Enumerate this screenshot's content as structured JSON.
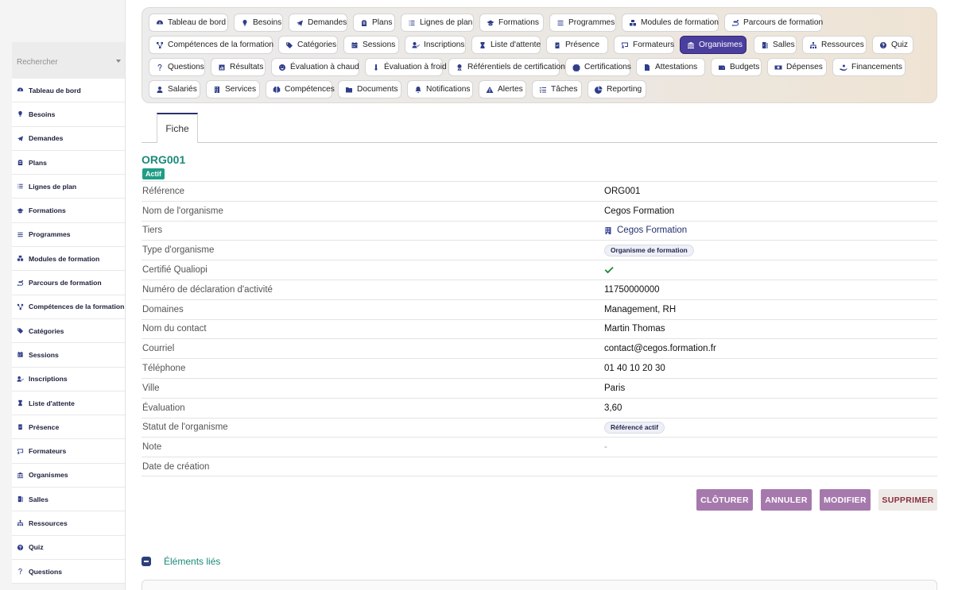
{
  "search": {
    "placeholder": "Rechercher"
  },
  "sidebar": {
    "items": [
      {
        "label": "Tableau de bord",
        "icon": "dashboard-icon"
      },
      {
        "label": "Besoins",
        "icon": "lightbulb-icon"
      },
      {
        "label": "Demandes",
        "icon": "paper-plane-icon"
      },
      {
        "label": "Plans",
        "icon": "clipboard-icon"
      },
      {
        "label": "Lignes de plan",
        "icon": "list-icon"
      },
      {
        "label": "Formations",
        "icon": "graduation-cap-icon"
      },
      {
        "label": "Programmes",
        "icon": "bars-icon"
      },
      {
        "label": "Modules de formation",
        "icon": "cubes-icon"
      },
      {
        "label": "Parcours de formation",
        "icon": "route-icon"
      },
      {
        "label": "Compétences de la formation",
        "icon": "project-diagram-icon"
      },
      {
        "label": "Catégories",
        "icon": "tags-icon"
      },
      {
        "label": "Sessions",
        "icon": "calendar-icon"
      },
      {
        "label": "Inscriptions",
        "icon": "user-check-icon"
      },
      {
        "label": "Liste d'attente",
        "icon": "hourglass-icon"
      },
      {
        "label": "Présence",
        "icon": "clipboard-check-icon"
      },
      {
        "label": "Formateurs",
        "icon": "chalkboard-teacher-icon"
      },
      {
        "label": "Organismes",
        "icon": "landmark-icon"
      },
      {
        "label": "Salles",
        "icon": "door-icon"
      },
      {
        "label": "Ressources",
        "icon": "sitemap-icon"
      },
      {
        "label": "Quiz",
        "icon": "question-circle-icon"
      },
      {
        "label": "Questions",
        "icon": "question-icon"
      }
    ]
  },
  "topnav": {
    "rows": [
      [
        {
          "label": "Tableau de bord",
          "icon": "dashboard-icon",
          "active": false
        },
        {
          "label": "Besoins",
          "icon": "lightbulb-icon",
          "active": false
        },
        {
          "label": "Demandes",
          "icon": "paper-plane-icon",
          "active": false
        },
        {
          "label": "Plans",
          "icon": "clipboard-icon",
          "active": false
        },
        {
          "label": "Lignes de plan",
          "icon": "list-icon",
          "active": false
        },
        {
          "label": "Formations",
          "icon": "graduation-cap-icon",
          "active": false
        },
        {
          "label": "Programmes",
          "icon": "bars-icon",
          "active": false
        },
        {
          "label": "Modules de formation",
          "icon": "cubes-icon",
          "active": false
        },
        {
          "label": "Parcours de formation",
          "icon": "route-icon",
          "active": false
        }
      ],
      [
        {
          "label": "Compétences de la formation",
          "icon": "project-diagram-icon",
          "active": false
        },
        {
          "label": "Catégories",
          "icon": "tags-icon",
          "active": false
        },
        {
          "label": "Sessions",
          "icon": "calendar-icon",
          "active": false
        },
        {
          "label": "Inscriptions",
          "icon": "user-check-icon",
          "active": false
        },
        {
          "label": "Liste d'attente",
          "icon": "hourglass-icon",
          "active": false
        },
        {
          "label": "Présence",
          "icon": "clipboard-check-icon",
          "active": false
        },
        {
          "label": "Formateurs",
          "icon": "chalkboard-teacher-icon",
          "active": false
        },
        {
          "label": "Organismes",
          "icon": "landmark-icon",
          "active": true
        },
        {
          "label": "Salles",
          "icon": "door-icon",
          "active": false
        },
        {
          "label": "Ressources",
          "icon": "sitemap-icon",
          "active": false
        },
        {
          "label": "Quiz",
          "icon": "question-circle-icon",
          "active": false
        }
      ],
      [
        {
          "label": "Questions",
          "icon": "question-icon",
          "active": false
        },
        {
          "label": "Résultats",
          "icon": "poll-icon",
          "active": false
        },
        {
          "label": "Évaluation à chaud",
          "icon": "smile-icon",
          "active": false
        },
        {
          "label": "Évaluation à froid",
          "icon": "thermometer-icon",
          "active": false
        },
        {
          "label": "Référentiels de certification",
          "icon": "award-icon",
          "active": false
        },
        {
          "label": "Certifications",
          "icon": "certificate-icon",
          "active": false
        },
        {
          "label": "Attestations",
          "icon": "file-signature-icon",
          "active": false
        },
        {
          "label": "Budgets",
          "icon": "wallet-icon",
          "active": false
        },
        {
          "label": "Dépenses",
          "icon": "money-bill-icon",
          "active": false
        },
        {
          "label": "Financements",
          "icon": "hand-holding-icon",
          "active": false
        }
      ],
      [
        {
          "label": "Salariés",
          "icon": "user-icon",
          "active": false
        },
        {
          "label": "Services",
          "icon": "building-icon",
          "active": false
        },
        {
          "label": "Compétences",
          "icon": "brain-icon",
          "active": false
        },
        {
          "label": "Documents",
          "icon": "folder-icon",
          "active": false
        },
        {
          "label": "Notifications",
          "icon": "bell-icon",
          "active": false
        },
        {
          "label": "Alertes",
          "icon": "warning-icon",
          "active": false
        },
        {
          "label": "Tâches",
          "icon": "tasks-icon",
          "active": false
        },
        {
          "label": "Reporting",
          "icon": "chart-pie-icon",
          "active": false
        }
      ]
    ]
  },
  "tabs": {
    "fiche": "Fiche"
  },
  "record": {
    "title": "ORG001",
    "status": "Actif",
    "fields": [
      {
        "label": "Référence",
        "value": "ORG001",
        "kind": "text"
      },
      {
        "label": "Nom de l'organisme",
        "value": "Cegos Formation",
        "kind": "text"
      },
      {
        "label": "Tiers",
        "value": "Cegos Formation",
        "kind": "link"
      },
      {
        "label": "Type d'organisme",
        "value": "Organisme de formation",
        "kind": "badge"
      },
      {
        "label": "Certifié Qualiopi",
        "value": "",
        "kind": "check"
      },
      {
        "label": "Numéro de déclaration d'activité",
        "value": "11750000000",
        "kind": "text"
      },
      {
        "label": "Domaines",
        "value": "Management, RH",
        "kind": "text"
      },
      {
        "label": "Nom du contact",
        "value": "Martin Thomas",
        "kind": "text"
      },
      {
        "label": "Courriel",
        "value": "contact@cegos.formation.fr",
        "kind": "text"
      },
      {
        "label": "Téléphone",
        "value": "01 40 10 20 30",
        "kind": "text"
      },
      {
        "label": "Ville",
        "value": "Paris",
        "kind": "text"
      },
      {
        "label": "Évaluation",
        "value": "3,60",
        "kind": "text"
      },
      {
        "label": "Statut de l'organisme",
        "value": "Référencé actif",
        "kind": "badge"
      },
      {
        "label": "Note",
        "value": "-",
        "kind": "muted"
      },
      {
        "label": "Date de création",
        "value": "",
        "kind": "text"
      }
    ]
  },
  "actions": {
    "cloturer": "CLÔTURER",
    "annuler": "ANNULER",
    "modifier": "MODIFIER",
    "supprimer": "SUPPRIMER"
  },
  "linked": {
    "title": "Éléments liés"
  },
  "colors": {
    "accent": "#4b3f9e",
    "teal": "#1a8a7a",
    "button_purple": "#a679ad",
    "status_green": "#1e9e86"
  }
}
